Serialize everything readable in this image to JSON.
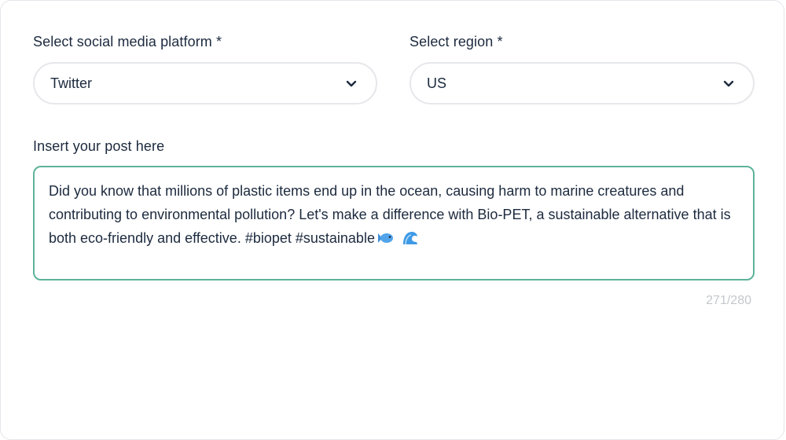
{
  "platform": {
    "label": "Select social media platform *",
    "value": "Twitter"
  },
  "region": {
    "label": "Select region *",
    "value": "US"
  },
  "post": {
    "label": "Insert your post here",
    "text": "Did you know that millions of plastic items end up in the ocean, causing harm to marine creatures and contributing to environmental pollution? Let's make a difference with Bio-PET, a sustainable alternative that is both eco-friendly and effective. #biopet #sustainable",
    "emojis": [
      "fish-icon",
      "wave-icon"
    ],
    "accent_color": "#5db39a"
  },
  "counter": {
    "text": "271/280"
  }
}
